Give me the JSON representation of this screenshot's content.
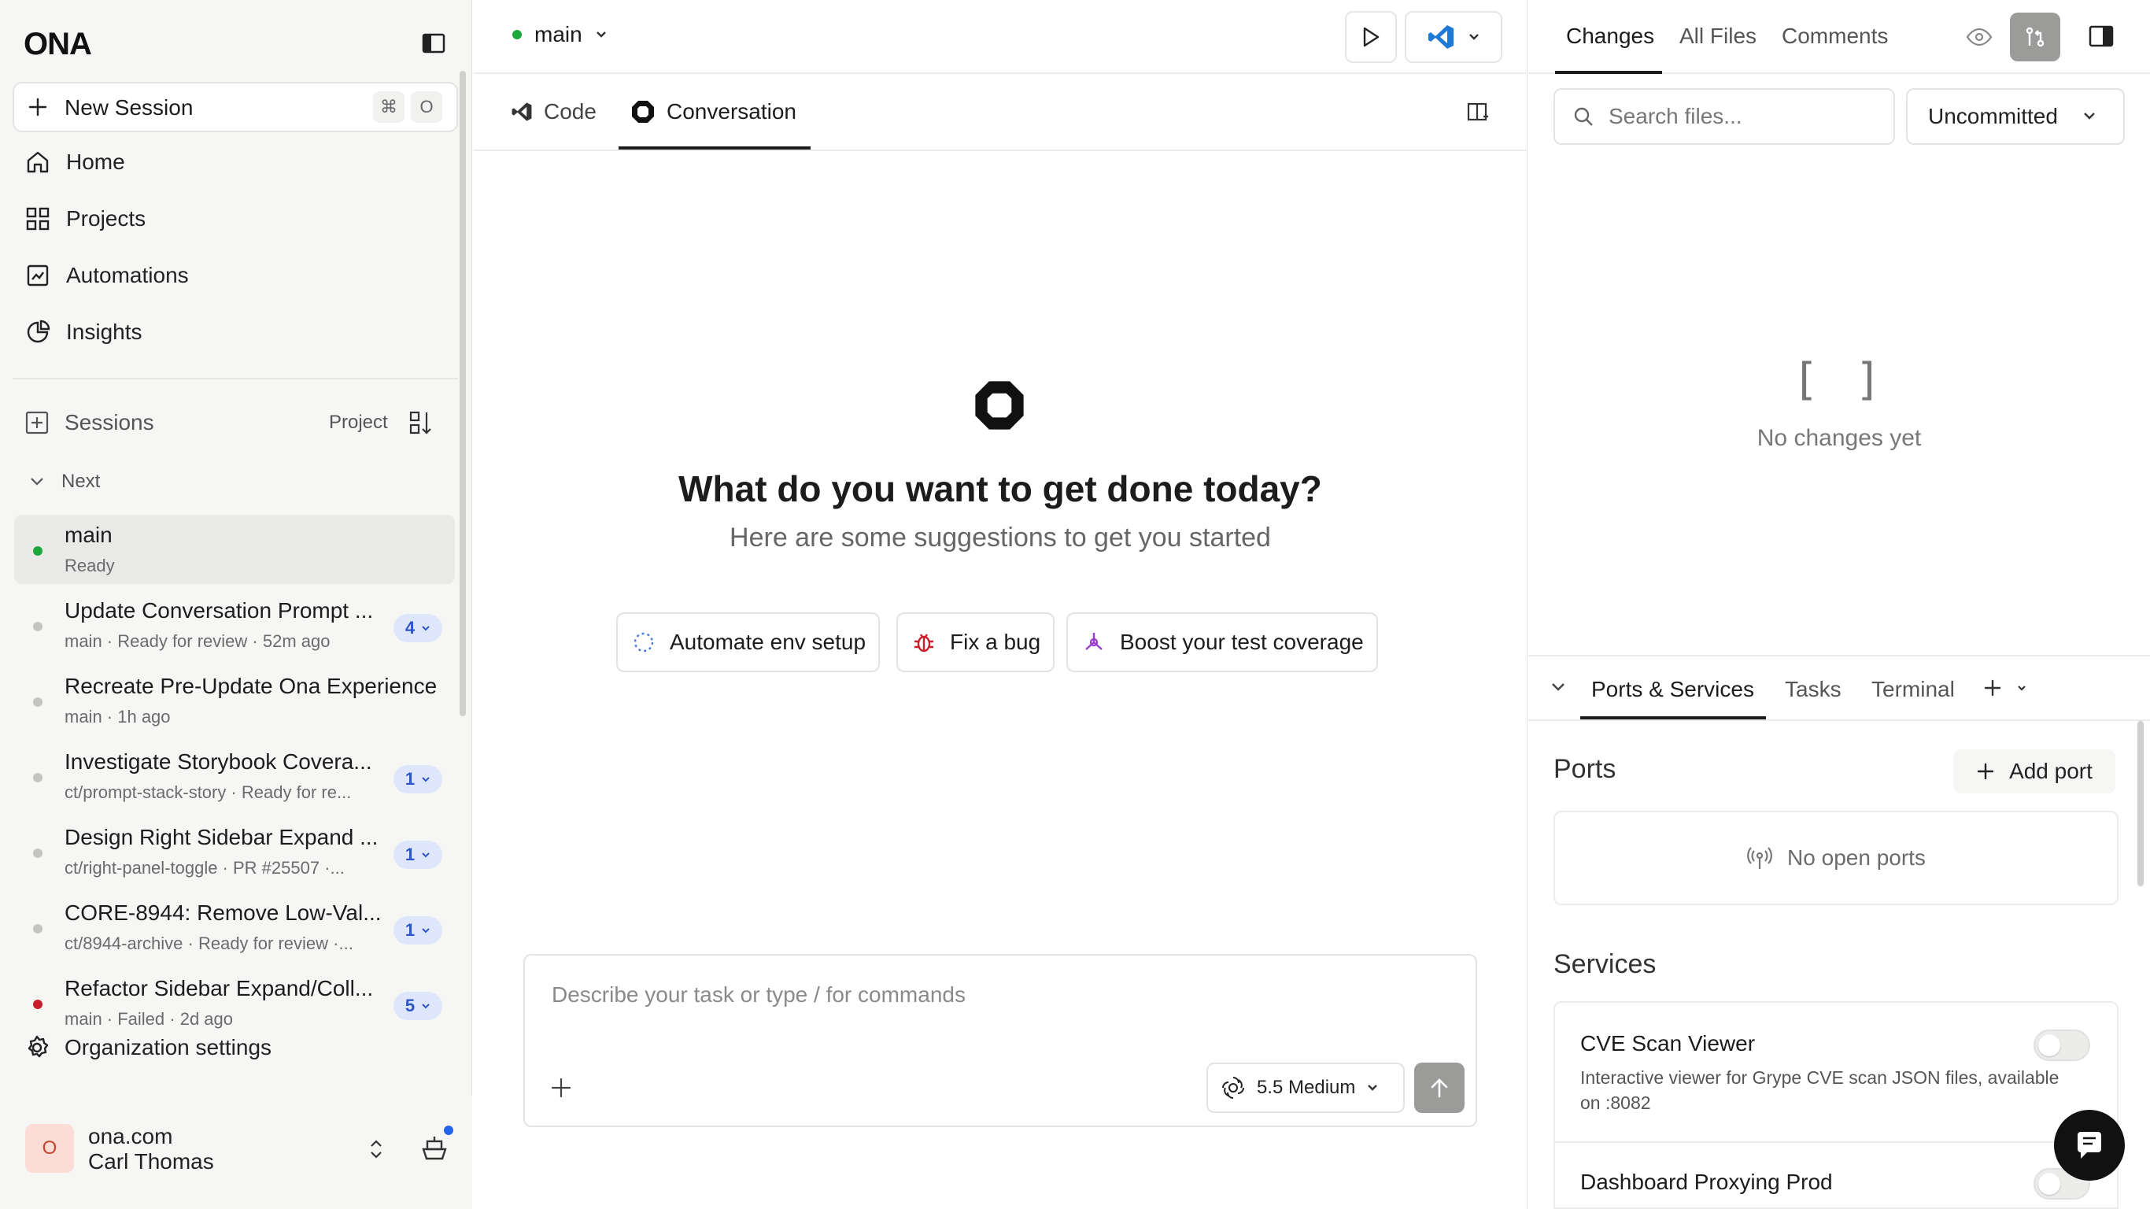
{
  "brand": {
    "logo": "ONA"
  },
  "sidebar": {
    "new_session": {
      "label": "New Session",
      "shortcut_cmd": "⌘",
      "shortcut_key": "O"
    },
    "nav": [
      {
        "label": "Home",
        "icon": "home-icon"
      },
      {
        "label": "Projects",
        "icon": "grid-icon"
      },
      {
        "label": "Automations",
        "icon": "automation-icon"
      },
      {
        "label": "Insights",
        "icon": "pie-chart-icon"
      }
    ],
    "sessions_header": {
      "label": "Sessions",
      "group_by": "Project"
    },
    "group": {
      "label": "Next"
    },
    "sessions": [
      {
        "title": "main",
        "subtitle": "Ready",
        "status_color": "#1ea83c",
        "badge": ""
      },
      {
        "title": "Update Conversation Prompt ...",
        "subtitle": "main · Ready for review · 52m ago",
        "status_color": "#c4c4c2",
        "badge": "4"
      },
      {
        "title": "Recreate Pre-Update Ona Experience",
        "subtitle": "main · 1h ago",
        "status_color": "#c4c4c2",
        "badge": ""
      },
      {
        "title": "Investigate Storybook Covera...",
        "subtitle": "ct/prompt-stack-story · Ready for re...",
        "status_color": "#c4c4c2",
        "badge": "1"
      },
      {
        "title": "Design Right Sidebar Expand ...",
        "subtitle": "ct/right-panel-toggle · PR #25507 ·...",
        "status_color": "#c4c4c2",
        "badge": "1"
      },
      {
        "title": "CORE-8944: Remove Low-Val...",
        "subtitle": "ct/8944-archive · Ready for review ·...",
        "status_color": "#c4c4c2",
        "badge": "1"
      },
      {
        "title": "Refactor Sidebar Expand/Coll...",
        "subtitle": "main · Failed · 2d ago",
        "status_color": "#c8202a",
        "badge": "5"
      }
    ],
    "org_settings": "Organization settings",
    "user": {
      "avatar_letter": "O",
      "org": "ona.com",
      "name": "Carl Thomas"
    }
  },
  "center": {
    "branch": "main",
    "tabs": [
      {
        "label": "Code"
      },
      {
        "label": "Conversation"
      }
    ],
    "heading": "What do you want to get done today?",
    "subheading": "Here are some suggestions to get you started",
    "suggestions": [
      {
        "label": "Automate env setup",
        "icon": "spinner-icon"
      },
      {
        "label": "Fix a bug",
        "icon": "bug-icon"
      },
      {
        "label": "Boost your test coverage",
        "icon": "flask-icon"
      }
    ],
    "composer": {
      "placeholder": "Describe your task or type / for commands",
      "model": "5.5 Medium"
    }
  },
  "right": {
    "tabs": [
      "Changes",
      "All Files",
      "Comments"
    ],
    "search_placeholder": "Search files...",
    "filter": "Uncommitted",
    "empty_icon": "[ ]",
    "empty_text": "No changes yet",
    "bottom_tabs": [
      "Ports & Services",
      "Tasks",
      "Terminal"
    ],
    "ports_title": "Ports",
    "add_port": "Add port",
    "no_ports": "No open ports",
    "services_title": "Services",
    "services": [
      {
        "name": "CVE Scan Viewer",
        "desc_line1": "Interactive viewer for Grype CVE scan JSON files, available",
        "desc_line2": "on :8082"
      },
      {
        "name": "Dashboard Proxying Prod",
        "desc_line1": "",
        "desc_line2": ""
      }
    ]
  },
  "colors": {
    "accent": "#2d55c8",
    "ready": "#1ea83c",
    "failed": "#c8202a",
    "notify": "#2563eb"
  }
}
